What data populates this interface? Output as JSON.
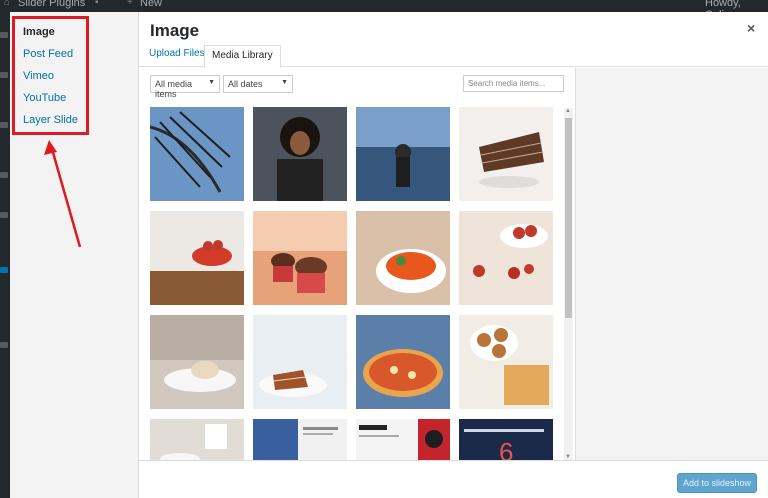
{
  "admin_bar": {
    "site_name": "Slider Plugins",
    "new_label": "New",
    "greeting": "Howdy, Colin"
  },
  "menu": {
    "items": [
      {
        "label": "Image",
        "active": true
      },
      {
        "label": "Post Feed",
        "active": false
      },
      {
        "label": "Vimeo",
        "active": false
      },
      {
        "label": "YouTube",
        "active": false
      },
      {
        "label": "Layer Slide",
        "active": false
      }
    ]
  },
  "modal": {
    "title": "Image",
    "close_icon": "×"
  },
  "tabs": [
    {
      "label": "Upload Files",
      "active": false
    },
    {
      "label": "Media Library",
      "active": true
    }
  ],
  "filters": {
    "media_type": "All media items",
    "dates": "All dates",
    "search_placeholder": "Search media items..."
  },
  "thumbnails": [
    {
      "name": "palm-leaves"
    },
    {
      "name": "woman-curly-hair"
    },
    {
      "name": "woman-in-sea"
    },
    {
      "name": "chocolate-cake-slice"
    },
    {
      "name": "strawberries-bowl-table"
    },
    {
      "name": "cupcake"
    },
    {
      "name": "vegetable-bowl"
    },
    {
      "name": "strawberries-bowl"
    },
    {
      "name": "pastry-cafe"
    },
    {
      "name": "cake-plate"
    },
    {
      "name": "pizza"
    },
    {
      "name": "cinnamon-rolls"
    },
    {
      "name": "coffee-cup"
    },
    {
      "name": "blue-website"
    },
    {
      "name": "webpool-website"
    },
    {
      "name": "web-animation-site"
    }
  ],
  "footer": {
    "add_button": "Add to slideshow"
  },
  "colors": {
    "accent": "#0073aa",
    "highlight_box": "#e01a22",
    "button": "#5ea5cf"
  }
}
